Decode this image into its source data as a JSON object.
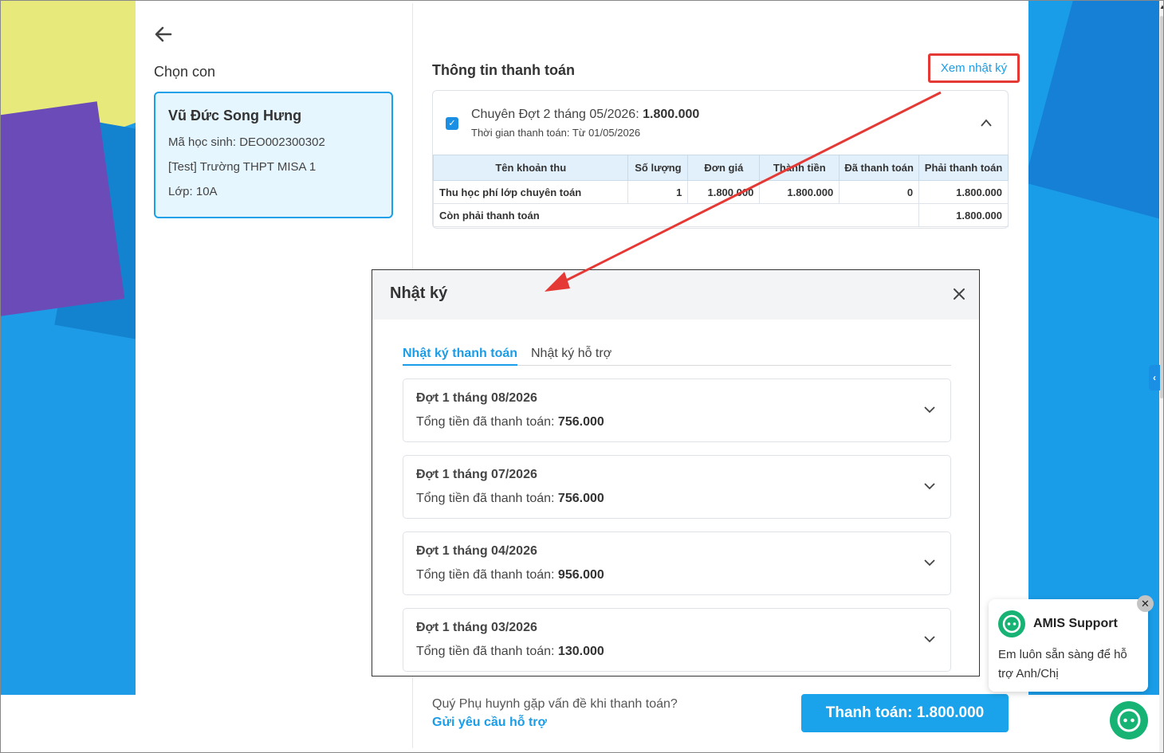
{
  "left": {
    "choose_title": "Chọn con",
    "student": {
      "name": "Vũ Đức Song Hưng",
      "code": "Mã học sinh: DEO002300302",
      "school": "[Test] Trường THPT MISA 1",
      "class": "Lớp: 10A"
    }
  },
  "payment": {
    "title": "Thông tin thanh toán",
    "log_link": "Xem nhật ký",
    "item_title_prefix": "Chuyên Đợt 2 tháng 05/2026: ",
    "item_title_amount": "1.800.000",
    "item_time": "Thời gian thanh toán: Từ 01/05/2026",
    "table": {
      "headers": [
        "Tên khoản thu",
        "Số lượng",
        "Đơn giá",
        "Thành tiền",
        "Đã thanh toán",
        "Phải thanh toán"
      ],
      "rows": [
        [
          "Thu học phí lớp chuyên toán",
          "1",
          "1.800.000",
          "1.800.000",
          "0",
          "1.800.000"
        ]
      ],
      "remaining_label": "Còn phải thanh toán",
      "remaining_value": "1.800.000"
    }
  },
  "modal": {
    "title": "Nhật ký",
    "tabs": [
      "Nhật ký thanh toán",
      "Nhật ký hỗ trợ"
    ],
    "items": [
      {
        "title": "Đợt 1 tháng 08/2026",
        "label": "Tổng tiền đã thanh toán: ",
        "amount": "756.000"
      },
      {
        "title": "Đợt 1 tháng 07/2026",
        "label": "Tổng tiền đã thanh toán: ",
        "amount": "756.000"
      },
      {
        "title": "Đợt 1 tháng 04/2026",
        "label": "Tổng tiền đã thanh toán: ",
        "amount": "956.000"
      },
      {
        "title": "Đợt 1 tháng 03/2026",
        "label": "Tổng tiền đã thanh toán: ",
        "amount": "130.000"
      }
    ]
  },
  "footer": {
    "help_text": "Quý Phụ huynh gặp vấn đề khi thanh toán?",
    "help_link": "Gửi yêu cầu hỗ trợ",
    "pay_button": "Thanh toán: 1.800.000"
  },
  "support": {
    "name": "AMIS Support",
    "message": "Em luôn sẵn sàng để hỗ trợ Anh/Chị"
  },
  "colors": {
    "accent": "#1a9de8",
    "annotation": "#e53935",
    "support_green": "#16b374"
  }
}
